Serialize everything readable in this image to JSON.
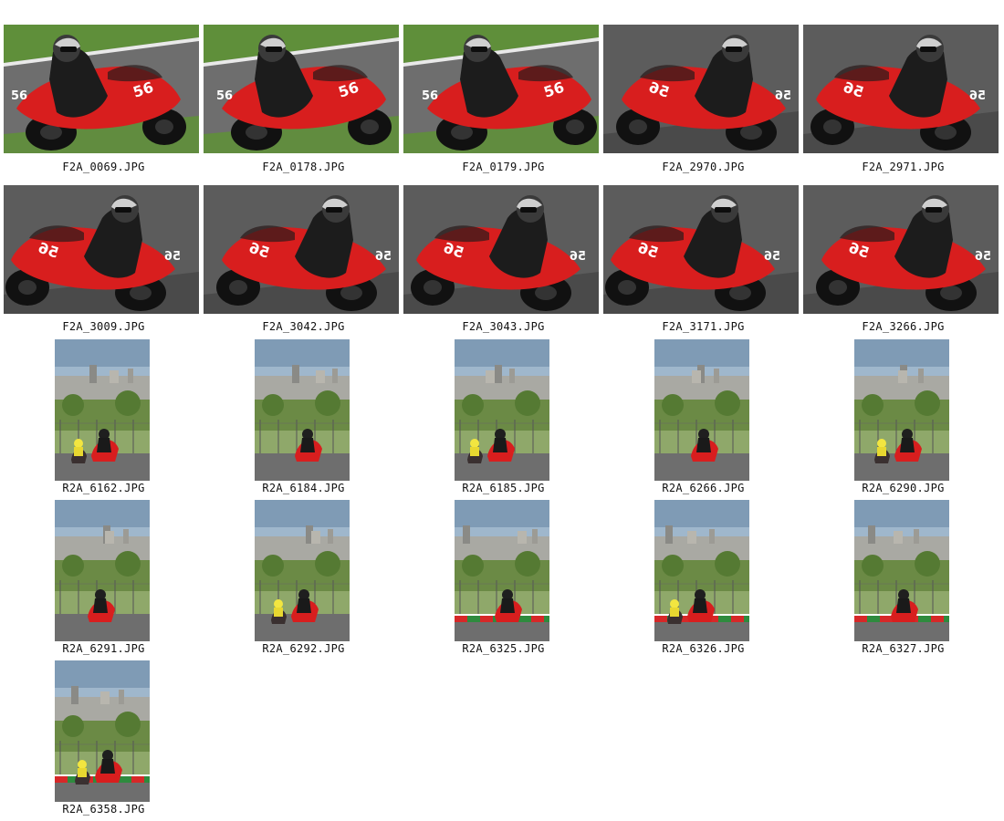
{
  "gallery": {
    "rows": [
      [
        "F2A_0069.JPG",
        "F2A_0178.JPG",
        "F2A_0179.JPG",
        "F2A_2970.JPG",
        "F2A_2971.JPG"
      ],
      [
        "F2A_3009.JPG",
        "F2A_3042.JPG",
        "F2A_3043.JPG",
        "F2A_3171.JPG",
        "F2A_3266.JPG"
      ],
      [
        "R2A_6162.JPG",
        "R2A_6184.JPG",
        "R2A_6185.JPG",
        "R2A_6266.JPG",
        "R2A_6290.JPG"
      ],
      [
        "R2A_6291.JPG",
        "R2A_6292.JPG",
        "R2A_6325.JPG",
        "R2A_6326.JPG",
        "R2A_6327.JPG"
      ],
      [
        "R2A_6358.JPG"
      ]
    ],
    "items": [
      {
        "filename": "F2A_0069.JPG",
        "orientation": "landscape",
        "bike_number": "56",
        "facing": "right"
      },
      {
        "filename": "F2A_0178.JPG",
        "orientation": "landscape",
        "bike_number": "56",
        "facing": "right"
      },
      {
        "filename": "F2A_0179.JPG",
        "orientation": "landscape",
        "bike_number": "56",
        "facing": "right"
      },
      {
        "filename": "F2A_2970.JPG",
        "orientation": "landscape",
        "bike_number": "56",
        "facing": "left"
      },
      {
        "filename": "F2A_2971.JPG",
        "orientation": "landscape",
        "bike_number": "56",
        "facing": "left"
      },
      {
        "filename": "F2A_3009.JPG",
        "orientation": "landscape",
        "bike_number": "56",
        "facing": "left"
      },
      {
        "filename": "F2A_3042.JPG",
        "orientation": "landscape",
        "bike_number": "56",
        "facing": "left"
      },
      {
        "filename": "F2A_3043.JPG",
        "orientation": "landscape",
        "bike_number": "56",
        "facing": "left"
      },
      {
        "filename": "F2A_3171.JPG",
        "orientation": "landscape",
        "bike_number": "56",
        "facing": "left"
      },
      {
        "filename": "F2A_3266.JPG",
        "orientation": "landscape",
        "bike_number": "56",
        "facing": "left"
      },
      {
        "filename": "R2A_6162.JPG",
        "orientation": "portrait"
      },
      {
        "filename": "R2A_6184.JPG",
        "orientation": "portrait"
      },
      {
        "filename": "R2A_6185.JPG",
        "orientation": "portrait"
      },
      {
        "filename": "R2A_6266.JPG",
        "orientation": "portrait"
      },
      {
        "filename": "R2A_6290.JPG",
        "orientation": "portrait"
      },
      {
        "filename": "R2A_6291.JPG",
        "orientation": "portrait"
      },
      {
        "filename": "R2A_6292.JPG",
        "orientation": "portrait"
      },
      {
        "filename": "R2A_6325.JPG",
        "orientation": "portrait"
      },
      {
        "filename": "R2A_6326.JPG",
        "orientation": "portrait"
      },
      {
        "filename": "R2A_6327.JPG",
        "orientation": "portrait"
      },
      {
        "filename": "R2A_6358.JPG",
        "orientation": "portrait"
      }
    ]
  },
  "colors": {
    "background": "#ffffff",
    "track_asphalt": "#6e6e6e",
    "grass": "#5f8f3a",
    "bike_red": "#d81e1e",
    "rider_suit": "#1c1c1c",
    "sky": "#9fb7cc",
    "city": "#a9a9a3",
    "curb_red": "#d62828",
    "curb_green": "#2e8b3e"
  }
}
